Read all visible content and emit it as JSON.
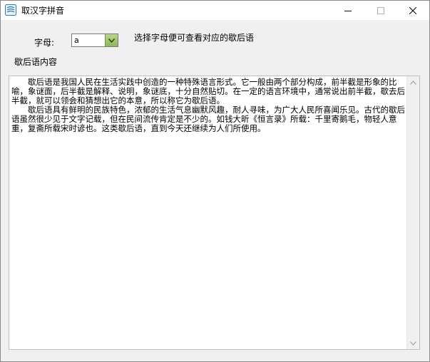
{
  "window": {
    "title": "取汉字拼音"
  },
  "form": {
    "letter_label": "字母:",
    "letter_value": "a",
    "hint": "选择字母便可查看对应的歇后语",
    "content_label": "歇后语内容"
  },
  "content": {
    "paragraphs": [
      "歇后语是我国人民在生活实践中创造的一种特殊语言形式。它一般由两个部分构成，前半截是形象的比喻，象谜面，后半截是解释、说明，象谜底，十分自然贴切。在一定的语言环境中，通常说出前半截，歇去后半截，就可以领会和猜想出它的本意，所以称它为歇后语。",
      "歇后语具有鲜明的民族特色，浓郁的生活气息幽默风趣，耐人寻味，为广大人民所喜闻乐见。古代的歇后语虽然很少见于文字记载，但在民间流传肯定是不少的。如钱大昕《恒言录》所载：千里寄鹅毛，物轻人意重，复斋所载宋时谚也。这类歇后语，直到今天还继续为人们所使用。"
    ]
  },
  "icons": {
    "app": "app-icon",
    "minimize": "minimize-icon",
    "maximize": "maximize-icon",
    "close": "close-icon",
    "dropdown": "chevron-down-icon"
  },
  "colors": {
    "combo_button": "#9cc46a"
  }
}
